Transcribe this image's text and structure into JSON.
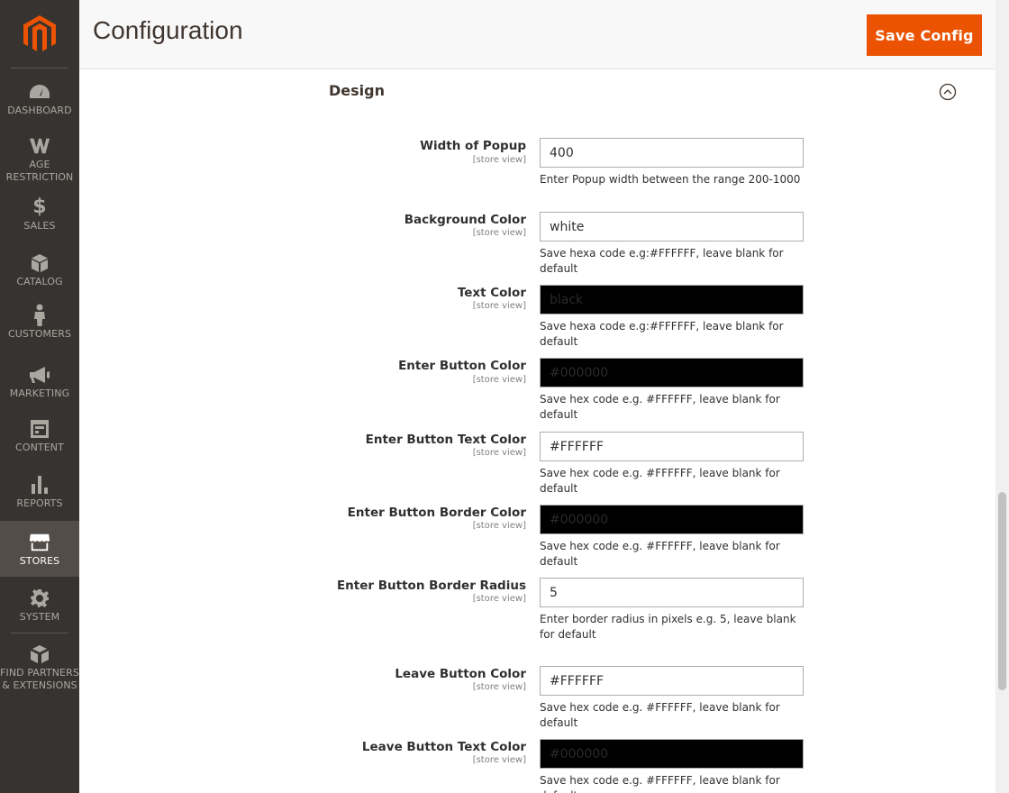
{
  "sidebar": {
    "items": [
      {
        "label": "DASHBOARD",
        "icon": "dashboard-icon"
      },
      {
        "label": "AGE\nRESTRICTION",
        "icon": "age-restriction-icon"
      },
      {
        "label": "SALES",
        "icon": "dollar-icon"
      },
      {
        "label": "CATALOG",
        "icon": "box-icon"
      },
      {
        "label": "CUSTOMERS",
        "icon": "person-icon"
      },
      {
        "label": "MARKETING",
        "icon": "megaphone-icon"
      },
      {
        "label": "CONTENT",
        "icon": "layout-icon"
      },
      {
        "label": "REPORTS",
        "icon": "bar-chart-icon"
      },
      {
        "label": "STORES",
        "icon": "storefront-icon"
      },
      {
        "label": "SYSTEM",
        "icon": "gear-icon"
      },
      {
        "label": "FIND PARTNERS\n& EXTENSIONS",
        "icon": "blocks-icon"
      }
    ],
    "active": "STORES"
  },
  "header": {
    "title": "Configuration",
    "save_label": "Save Config"
  },
  "section": {
    "title": "Design"
  },
  "fields": [
    {
      "label": "Width of Popup",
      "scope": "[store view]",
      "value": "400",
      "note": "Enter Popup width between the range 200-1000"
    },
    {
      "label": "Background Color",
      "scope": "[store view]",
      "value": "white",
      "note": "Save hexa code e.g:#FFFFFF, leave blank for default"
    },
    {
      "label": "Text Color",
      "scope": "[store view]",
      "value": "black",
      "note": "Save hexa code e.g:#FFFFFF, leave blank for default"
    },
    {
      "label": "Enter Button Color",
      "scope": "[store view]",
      "value": "#000000",
      "note": "Save hex code e.g. #FFFFFF, leave blank for default"
    },
    {
      "label": "Enter Button Text Color",
      "scope": "[store view]",
      "value": "#FFFFFF",
      "note": "Save hex code e.g. #FFFFFF, leave blank for default"
    },
    {
      "label": "Enter Button Border Color",
      "scope": "[store view]",
      "value": "#000000",
      "note": "Save hex code e.g. #FFFFFF, leave blank for default"
    },
    {
      "label": "Enter Button Border Radius",
      "scope": "[store view]",
      "value": "5",
      "note": "Enter border radius in pixels e.g. 5, leave blank for default"
    },
    {
      "label": "Leave Button Color",
      "scope": "[store view]",
      "value": "#FFFFFF",
      "note": "Save hex code e.g. #FFFFFF, leave blank for default"
    },
    {
      "label": "Leave Button Text Color",
      "scope": "[store view]",
      "value": "#000000",
      "note": "Save hex code e.g. #FFFFFF, leave blank for default"
    }
  ],
  "colors": {
    "sidebar_bg": "#373330",
    "sidebar_active": "#524d49",
    "accent": "#eb5202",
    "logo": "#eb5202"
  }
}
